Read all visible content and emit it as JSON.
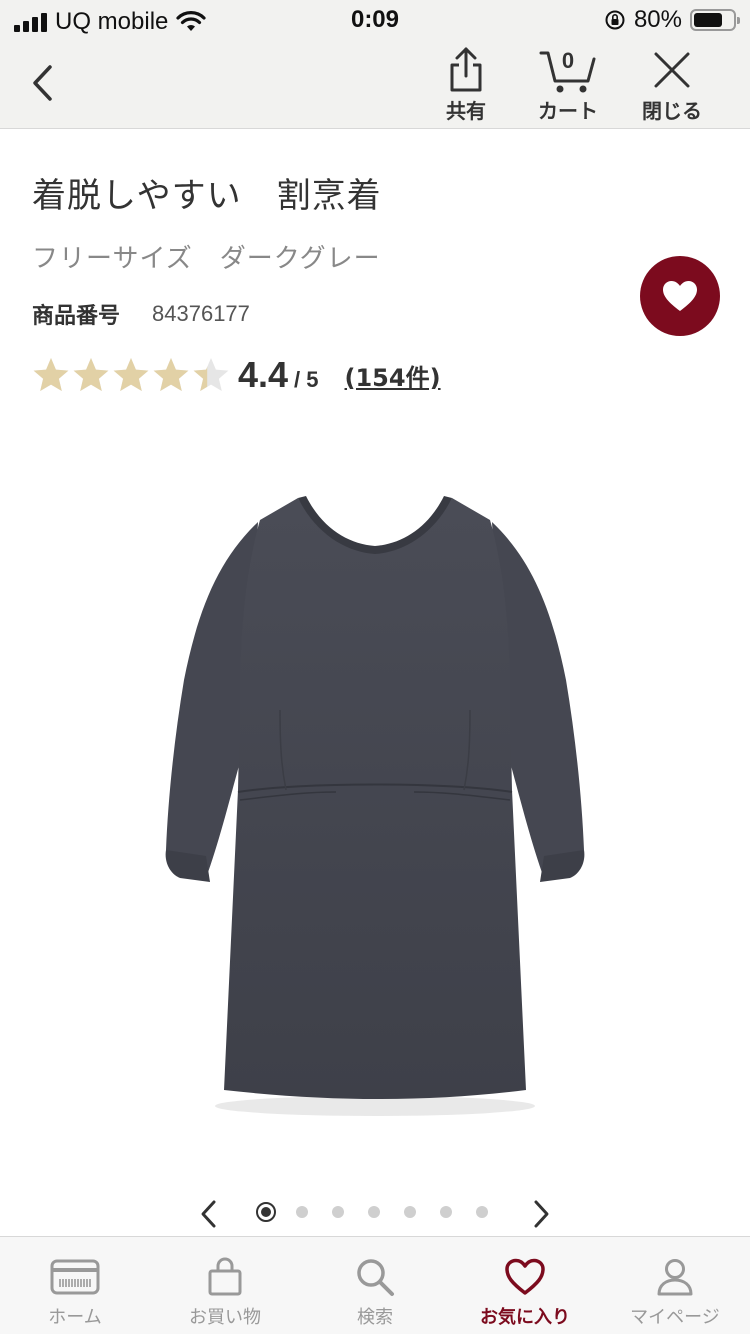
{
  "status_bar": {
    "carrier": "UQ mobile",
    "time": "0:09",
    "battery": "80%"
  },
  "nav": {
    "share_label": "共有",
    "cart_label": "カート",
    "cart_count": "0",
    "close_label": "閉じる"
  },
  "product": {
    "title": "着脱しやすい　割烹着",
    "variant": "フリーサイズ　ダークグレー",
    "code_label": "商品番号",
    "code_value": "84376177",
    "rating_value": "4.4",
    "rating_max": "/ 5",
    "rating": 4.4,
    "review_count": "(154件)",
    "image_icon": "garment-apron-illustration",
    "colors": {
      "accent": "#7c0b1e",
      "star": "#e2d1a6",
      "star_empty": "#e6e6e6",
      "garment": "#44464f"
    }
  },
  "carousel": {
    "total": 7,
    "active_index": 0
  },
  "tabs": [
    {
      "label": "ホーム",
      "icon": "card-icon",
      "active": false
    },
    {
      "label": "お買い物",
      "icon": "bag-icon",
      "active": false
    },
    {
      "label": "検索",
      "icon": "search-icon",
      "active": false
    },
    {
      "label": "お気に入り",
      "icon": "heart-icon",
      "active": true
    },
    {
      "label": "マイページ",
      "icon": "person-icon",
      "active": false
    }
  ]
}
